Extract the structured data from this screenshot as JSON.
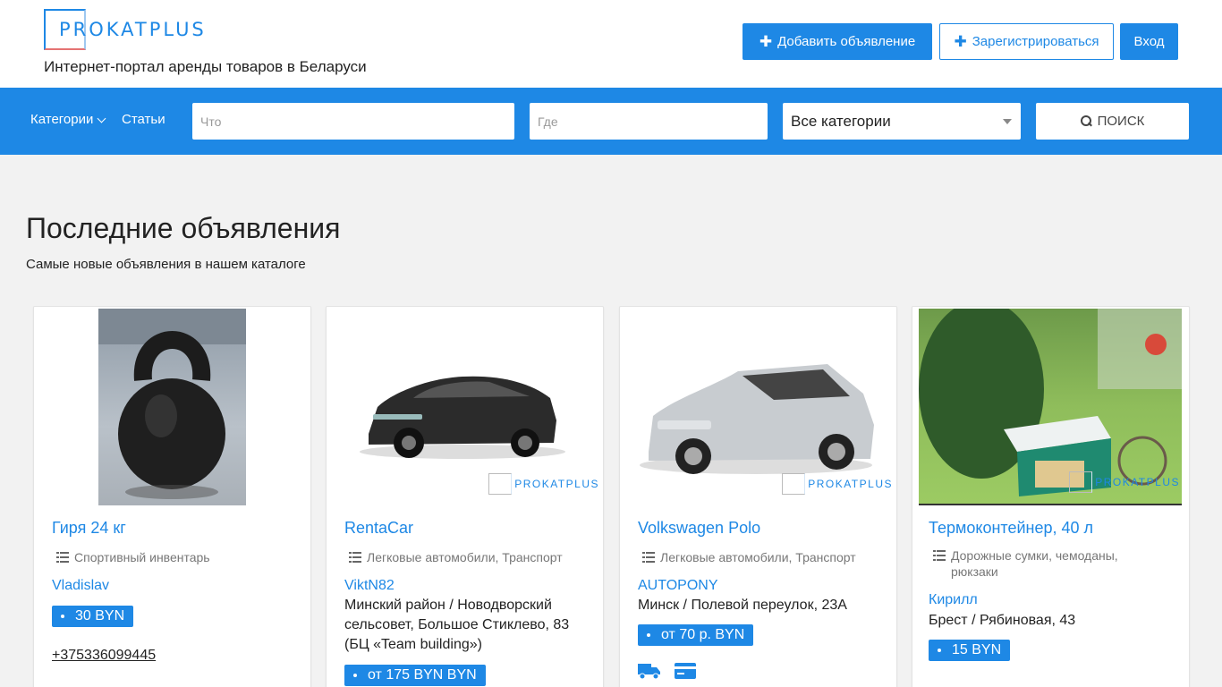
{
  "header": {
    "logo_text": "PROKATPLUS",
    "tagline": "Интернет-портал аренды товаров в Беларуси",
    "add_label": "Добавить объявление",
    "register_label": "Зарегистрироваться",
    "login_label": "Вход"
  },
  "searchbar": {
    "categories_label": "Категории",
    "articles_label": "Статьи",
    "what_placeholder": "Что",
    "where_placeholder": "Где",
    "category_select": "Все категории",
    "search_label": "ПОИСК"
  },
  "section": {
    "title": "Последние объявления",
    "subtitle": "Самые новые объявления в нашем каталоге"
  },
  "watermark": "PROKATPLUS",
  "listings": [
    {
      "title": "Гиря 24 кг",
      "category": "Спортивный инвентарь",
      "user": "Vladislav",
      "price": "30 BYN",
      "phone": "+375336099445"
    },
    {
      "title": "RentaCar",
      "category": "Легковые автомобили, Транспорт",
      "user": "ViktN82",
      "address": "Минский район / Новодворский сельсовет, Большое Стиклево, 83 (БЦ «Team building»)",
      "price": "от 175 BYN BYN"
    },
    {
      "title": "Volkswagen Polo",
      "category": "Легковые автомобили, Транспорт",
      "user": "AUTOPONY",
      "address": "Минск / Полевой переулок, 23А",
      "price": "от 70 р. BYN"
    },
    {
      "title": "Термоконтейнер, 40 л",
      "category": "Дорожные сумки, чемоданы, рюкзаки",
      "user": "Кирилл",
      "address": "Брест / Рябиновая, 43",
      "price": "15 BYN"
    }
  ],
  "colors": {
    "accent": "#1e88e5",
    "background": "#f2f2f2"
  }
}
